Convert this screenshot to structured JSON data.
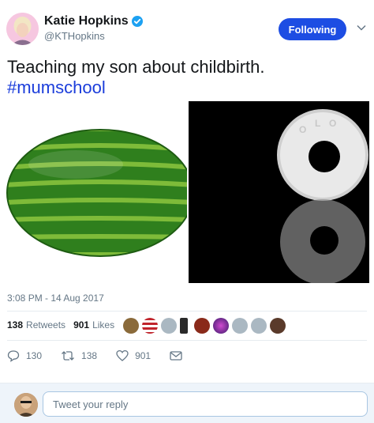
{
  "author": {
    "display_name": "Katie Hopkins",
    "handle": "@KTHopkins",
    "verified": true
  },
  "follow_button": {
    "label": "Following"
  },
  "tweet": {
    "text": "Teaching my son about childbirth.",
    "hashtag": "#mumschool",
    "timestamp": "3:08 PM - 14 Aug 2017"
  },
  "stats": {
    "retweets_count": "138",
    "retweets_label": "Retweets",
    "likes_count": "901",
    "likes_label": "Likes"
  },
  "actions": {
    "reply_count": "130",
    "retweet_count": "138",
    "like_count": "901"
  },
  "reply": {
    "placeholder": "Tweet your reply"
  },
  "colors": {
    "accent": "#1d4de3",
    "hashtag": "#1b3ddb",
    "muted": "#657786",
    "verified": "#1da1f2"
  }
}
